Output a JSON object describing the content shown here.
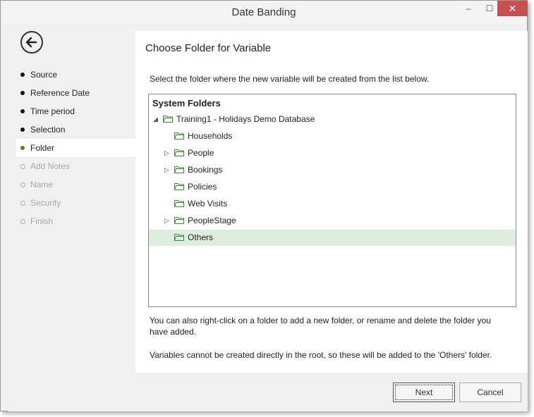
{
  "window": {
    "title": "Date Banding"
  },
  "titlebar": {
    "minimize": "–",
    "maximize": "☐",
    "close": "✕"
  },
  "nav": {
    "items": [
      {
        "label": "Source",
        "state": "done"
      },
      {
        "label": "Reference Date",
        "state": "done"
      },
      {
        "label": "Time period",
        "state": "done"
      },
      {
        "label": "Selection",
        "state": "done"
      },
      {
        "label": "Folder",
        "state": "active"
      },
      {
        "label": "Add Notes",
        "state": "disabled"
      },
      {
        "label": "Name",
        "state": "disabled"
      },
      {
        "label": "Security",
        "state": "disabled"
      },
      {
        "label": "Finish",
        "state": "disabled"
      }
    ]
  },
  "page": {
    "heading": "Choose Folder for Variable",
    "instruction": "Select the folder where the new variable will be created from the list below.",
    "hint_rename": "You can also right-click on a folder to add a new folder, or rename and delete the folder you have added.",
    "hint_root": "Variables cannot be created directly in the root, so these will be added to the 'Others' folder."
  },
  "tree": {
    "header": "System Folders",
    "rows": [
      {
        "label": "Training1 - Holidays Demo Database",
        "level": 0,
        "expander": "expanded",
        "selected": false
      },
      {
        "label": "Households",
        "level": 1,
        "expander": "none",
        "selected": false
      },
      {
        "label": "People",
        "level": 1,
        "expander": "collapsed",
        "selected": false
      },
      {
        "label": "Bookings",
        "level": 1,
        "expander": "collapsed",
        "selected": false
      },
      {
        "label": "Policies",
        "level": 1,
        "expander": "none",
        "selected": false
      },
      {
        "label": "Web Visits",
        "level": 1,
        "expander": "none",
        "selected": false
      },
      {
        "label": "PeopleStage",
        "level": 1,
        "expander": "collapsed",
        "selected": false
      },
      {
        "label": "Others",
        "level": 1,
        "expander": "none",
        "selected": true
      }
    ]
  },
  "footer": {
    "next_label": "Next",
    "cancel_label": "Cancel"
  },
  "colors": {
    "accent": "#3f8f2f",
    "selection": "#deeedd",
    "close": "#c7504f"
  },
  "icons": {
    "back": "back-arrow-icon",
    "folder": "folder-icon",
    "expand": "tree-expander-icon"
  }
}
